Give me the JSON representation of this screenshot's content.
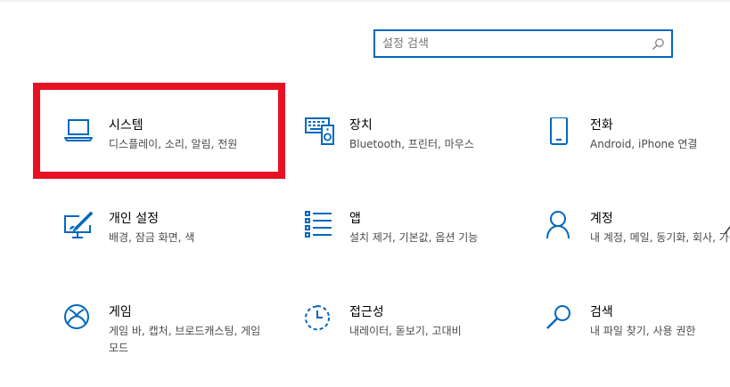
{
  "search": {
    "placeholder": "설정 검색",
    "icon": "search-icon"
  },
  "accent_color": "#0067c0",
  "highlight_color": "#e81123",
  "tiles": [
    {
      "title": "시스템",
      "desc": "디스플레이, 소리, 알림, 전원",
      "icon": "laptop-icon"
    },
    {
      "title": "장치",
      "desc": "Bluetooth, 프린터, 마우스",
      "icon": "devices-icon"
    },
    {
      "title": "전화",
      "desc": "Android, iPhone 연결",
      "icon": "phone-icon"
    },
    {
      "title": "개인 설정",
      "desc": "배경, 잠금 화면, 색",
      "icon": "personalization-icon"
    },
    {
      "title": "앱",
      "desc": "설치 제거, 기본값, 옵션 기능",
      "icon": "apps-list-icon"
    },
    {
      "title": "계정",
      "desc": "내 계정, 메일, 동기화, 회사, 가족",
      "icon": "account-person-icon"
    },
    {
      "title": "게임",
      "desc": "게임 바, 캡처, 브로드캐스팅, 게임 모드",
      "icon": "xbox-icon"
    },
    {
      "title": "접근성",
      "desc": "내레이터, 돋보기, 고대비",
      "icon": "ease-of-access-icon"
    },
    {
      "title": "검색",
      "desc": "내 파일 찾기, 사용 권한",
      "icon": "search-magnifier-icon"
    }
  ]
}
